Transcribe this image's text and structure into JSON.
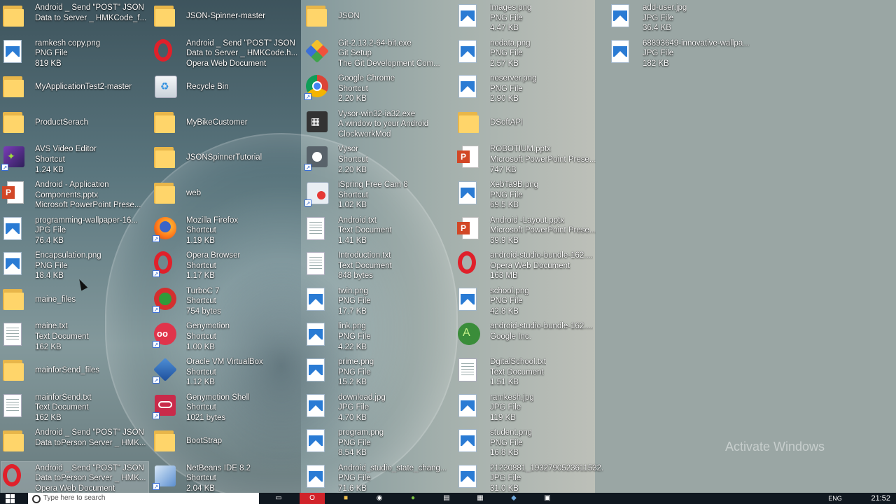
{
  "desktop": {
    "columns": [
      [
        {
          "type": "folder",
          "lines": [
            "Android _ Send \"POST\" JSON",
            "Data to Server _ HMKCode_f..."
          ]
        },
        {
          "type": "image",
          "lines": [
            "ramkesh copy.png",
            "PNG File",
            "819 KB"
          ]
        },
        {
          "type": "folder",
          "lines": [
            "MyApplicationTest2-master"
          ]
        },
        {
          "type": "folder",
          "lines": [
            "ProductSerach"
          ]
        },
        {
          "type": "avs",
          "lines": [
            "AVS Video Editor",
            "Shortcut",
            "1.24 KB"
          ]
        },
        {
          "type": "ppt",
          "lines": [
            "Android - Application",
            "Components.pptx",
            "Microsoft PowerPoint Prese..."
          ]
        },
        {
          "type": "image",
          "lines": [
            "programming-wallpaper-16...",
            "JPG File",
            "76.4 KB"
          ]
        },
        {
          "type": "image",
          "lines": [
            "Encapsulation.png",
            "PNG File",
            "18.4 KB"
          ]
        },
        {
          "type": "folder",
          "lines": [
            "maine_files"
          ]
        },
        {
          "type": "doc",
          "lines": [
            "maine.txt",
            "Text Document",
            "162 KB"
          ]
        },
        {
          "type": "folder",
          "lines": [
            "mainforSend_files"
          ]
        },
        {
          "type": "doc",
          "lines": [
            "mainforSend.txt",
            "Text Document",
            "162 KB"
          ]
        },
        {
          "type": "folder",
          "lines": [
            "Android _ Send \"POST\" JSON",
            "Data toPerson Server _ HMK..."
          ]
        },
        {
          "type": "opera",
          "selected": true,
          "lines": [
            "Android _ Send \"POST\" JSON",
            "Data toPerson Server _ HMK...",
            "Opera Web Document"
          ]
        }
      ],
      [
        {
          "type": "folder",
          "lines": [
            "JSON-Spinner-master"
          ]
        },
        {
          "type": "opera",
          "lines": [
            "Android _ Send \"POST\" JSON",
            "Data to Server _ HMKCode.h...",
            "Opera Web Document"
          ]
        },
        {
          "type": "recycle",
          "lines": [
            "Recycle Bin"
          ]
        },
        {
          "type": "folder",
          "lines": [
            "MyBikeCustomer"
          ]
        },
        {
          "type": "folder",
          "lines": [
            "JSONSpinnerTutorial"
          ]
        },
        {
          "type": "folder",
          "lines": [
            "web"
          ]
        },
        {
          "type": "firefox",
          "lines": [
            "Mozilla Firefox",
            "Shortcut",
            "1.19 KB"
          ]
        },
        {
          "type": "opera-sc",
          "lines": [
            "Opera Browser",
            "Shortcut",
            "1.17 KB"
          ]
        },
        {
          "type": "turboc",
          "lines": [
            "TurboC 7",
            "Shortcut",
            "754 bytes"
          ]
        },
        {
          "type": "genymotion",
          "lines": [
            "Genymotion",
            "Shortcut",
            "1.00 KB"
          ]
        },
        {
          "type": "virtualbox",
          "lines": [
            "Oracle VM VirtualBox",
            "Shortcut",
            "1.12 KB"
          ]
        },
        {
          "type": "genyshell",
          "lines": [
            "Genymotion Shell",
            "Shortcut",
            "1021 bytes"
          ]
        },
        {
          "type": "folder",
          "lines": [
            "BootStrap"
          ]
        },
        {
          "type": "netbeans",
          "lines": [
            "NetBeans IDE 8.2",
            "Shortcut",
            "2.04 KB"
          ]
        }
      ],
      [
        {
          "type": "folder",
          "lines": [
            "JSON"
          ]
        },
        {
          "type": "git",
          "lines": [
            "Git-2.13.2-64-bit.exe",
            "Git Setup",
            "The Git Development Com..."
          ]
        },
        {
          "type": "chrome",
          "lines": [
            "Google Chrome",
            "Shortcut",
            "2.20 KB"
          ]
        },
        {
          "type": "vysor-exe",
          "lines": [
            "Vysor-win32-ia32.exe",
            "A window to your Android",
            "ClockworkMod"
          ]
        },
        {
          "type": "vysor",
          "lines": [
            "Vysor",
            "Shortcut",
            "2.20 KB"
          ]
        },
        {
          "type": "ispring",
          "lines": [
            "iSpring Free Cam 8",
            "Shortcut",
            "1.02 KB"
          ]
        },
        {
          "type": "doc",
          "lines": [
            "Android.txt",
            "Text Document",
            "1.41 KB"
          ]
        },
        {
          "type": "doc",
          "lines": [
            "Introduction.txt",
            "Text Document",
            "848 bytes"
          ]
        },
        {
          "type": "image",
          "lines": [
            "twin.png",
            "PNG File",
            "17.7 KB"
          ]
        },
        {
          "type": "image",
          "lines": [
            "link.png",
            "PNG File",
            "4.22 KB"
          ]
        },
        {
          "type": "image",
          "lines": [
            "prime.png",
            "PNG File",
            "15.2 KB"
          ]
        },
        {
          "type": "image",
          "lines": [
            "download.jpg",
            "JPG File",
            "4.70 KB"
          ]
        },
        {
          "type": "image",
          "lines": [
            "program.png",
            "PNG File",
            "8.54 KB"
          ]
        },
        {
          "type": "image",
          "lines": [
            "Android_studio_state_chang...",
            "PNG File",
            "71.6 KB"
          ]
        }
      ],
      [
        {
          "type": "image",
          "lines": [
            "images.png",
            "PNG File",
            "4.47 KB"
          ]
        },
        {
          "type": "image",
          "lines": [
            "nodata.png",
            "PNG File",
            "2.57 KB"
          ]
        },
        {
          "type": "image",
          "lines": [
            "noserver.png",
            "PNG File",
            "2.90 KB"
          ]
        },
        {
          "type": "folder",
          "lines": [
            "DSoftAPI"
          ]
        },
        {
          "type": "ppt",
          "lines": [
            "ROBOTIUM.pptx",
            "Microsoft PowerPoint Prese...",
            "747 KB"
          ]
        },
        {
          "type": "image",
          "lines": [
            "XebTa9B.png",
            "PNG File",
            "69.5 KB"
          ]
        },
        {
          "type": "ppt",
          "lines": [
            "Android -Layout.pptx",
            "Microsoft PowerPoint Prese...",
            "39.9 KB"
          ]
        },
        {
          "type": "opera",
          "lines": [
            "android-studio-bundle-162....",
            "Opera Web Document",
            "163 MB"
          ]
        },
        {
          "type": "image",
          "lines": [
            "school.png",
            "PNG File",
            "42.8 KB"
          ]
        },
        {
          "type": "android",
          "lines": [
            "android-studio-bundle-162....",
            "Google Inc."
          ]
        },
        {
          "type": "doc",
          "lines": [
            "DgitalSchool.txt",
            "Text Document",
            "1.51 KB"
          ]
        },
        {
          "type": "image",
          "lines": [
            "ramkesh.jpg",
            "JPG File",
            "119 KB"
          ]
        },
        {
          "type": "image",
          "lines": [
            "student.png",
            "PNG File",
            "16.8 KB"
          ]
        },
        {
          "type": "image",
          "lines": [
            "21230881_1932790523611532...",
            "JPG File",
            "31.0 KB"
          ]
        }
      ],
      [
        {
          "type": "image",
          "lines": [
            "add-user.jpg",
            "JPG File",
            "36.4 KB"
          ]
        },
        {
          "type": "image",
          "lines": [
            "68893649-innovative-wallpa...",
            "JPG File",
            "182 KB"
          ]
        }
      ]
    ]
  },
  "watermark": "Activate Windows",
  "taskbar": {
    "search_placeholder": "Type here to search",
    "language": "ENG",
    "clock": "21:52"
  }
}
